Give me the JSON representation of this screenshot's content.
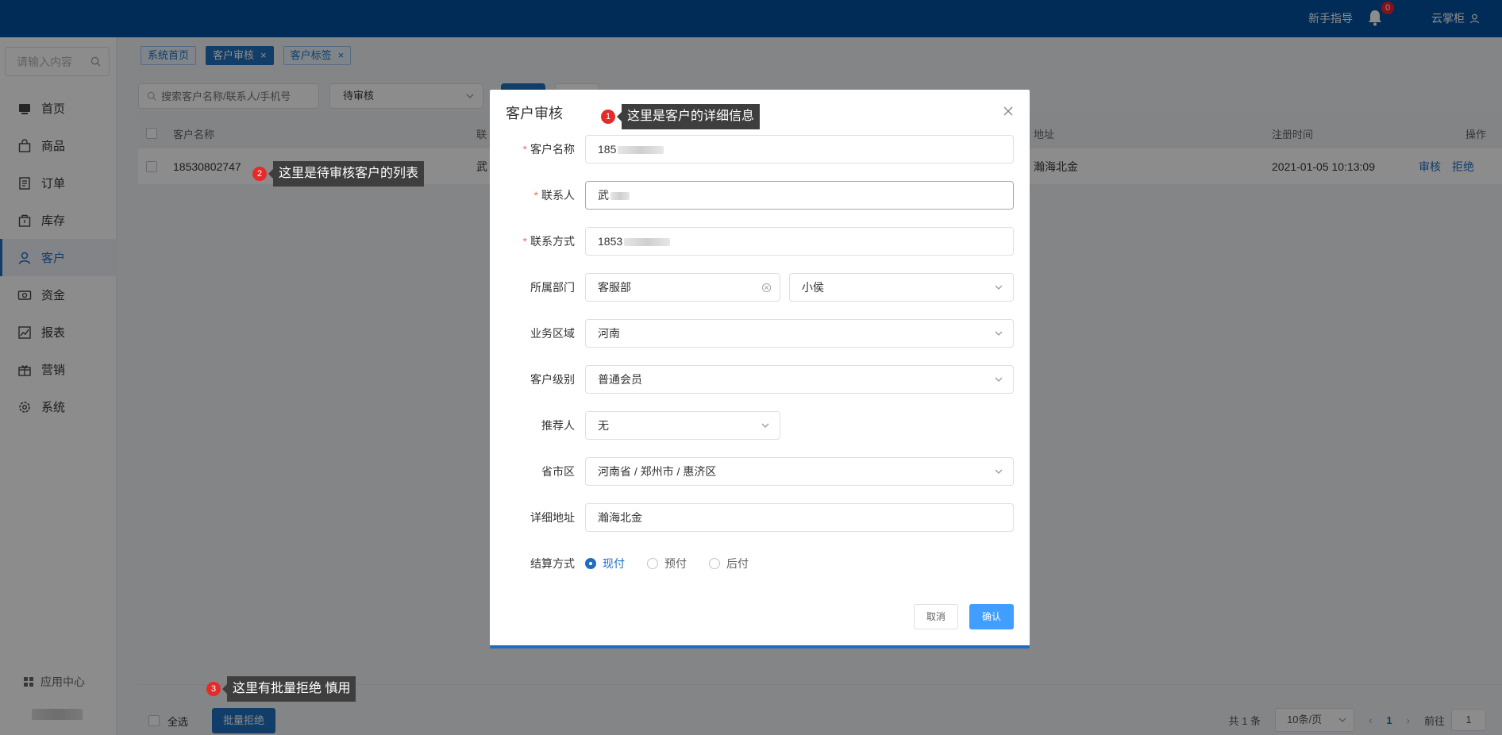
{
  "topbar": {
    "guide": "新手指导",
    "notif_count": "0",
    "user": "云掌柜"
  },
  "sidebar": {
    "search_placeholder": "请输入内容",
    "items": [
      {
        "label": "首页",
        "icon": "home-icon"
      },
      {
        "label": "商品",
        "icon": "bag-icon"
      },
      {
        "label": "订单",
        "icon": "order-icon"
      },
      {
        "label": "库存",
        "icon": "inventory-icon"
      },
      {
        "label": "客户",
        "icon": "user-icon",
        "active": true
      },
      {
        "label": "资金",
        "icon": "money-icon"
      },
      {
        "label": "报表",
        "icon": "chart-icon"
      },
      {
        "label": "营销",
        "icon": "gift-icon"
      },
      {
        "label": "系统",
        "icon": "gear-icon"
      }
    ],
    "app_center": "应用中心"
  },
  "tabs": [
    {
      "label": "系统首页"
    },
    {
      "label": "客户审核",
      "active": true
    },
    {
      "label": "客户标签"
    }
  ],
  "filter": {
    "search_placeholder": "搜索客户名称/联系人/手机号",
    "status": "待审核"
  },
  "table": {
    "headers": {
      "name": "客户名称",
      "contact": "联",
      "address": "地址",
      "reg_time": "注册时间",
      "ops": "操作"
    },
    "rows": [
      {
        "name": "18530802747",
        "contact": "武",
        "address": "瀚海北金",
        "reg_time": "2021-01-05 10:13:09",
        "op_review": "审核",
        "op_reject": "拒绝"
      }
    ]
  },
  "footer": {
    "select_all": "全选",
    "batch_reject": "批量拒绝"
  },
  "pager": {
    "total": "共 1 条",
    "page_size": "10条/页",
    "current": "1",
    "goto_label": "前往",
    "goto_value": "1"
  },
  "callouts": [
    {
      "num": "1",
      "text": "这里是客户的详细信息"
    },
    {
      "num": "2",
      "text": "这里是待审核客户的列表"
    },
    {
      "num": "3",
      "text": "这里有批量拒绝   慎用"
    }
  ],
  "dialog": {
    "title": "客户审核",
    "fields": {
      "name": {
        "label": "客户名称",
        "value": "185"
      },
      "contact": {
        "label": "联系人",
        "value": "武"
      },
      "phone": {
        "label": "联系方式",
        "value": "1853"
      },
      "dept": {
        "label": "所属部门",
        "value": "客服部",
        "staff": "小侯"
      },
      "region": {
        "label": "业务区域",
        "value": "河南"
      },
      "level": {
        "label": "客户级别",
        "value": "普通会员"
      },
      "referrer": {
        "label": "推荐人",
        "value": "无"
      },
      "province": {
        "label": "省市区",
        "value": "河南省 / 郑州市 / 惠济区"
      },
      "address": {
        "label": "详细地址",
        "value": "瀚海北金"
      },
      "settle": {
        "label": "结算方式",
        "options": [
          "现付",
          "预付",
          "后付"
        ],
        "selected": "现付"
      }
    },
    "cancel": "取消",
    "confirm": "确认"
  },
  "colors": {
    "topbar": "#00509e",
    "primary": "#1f6fbf",
    "confirm": "#409eff",
    "badge": "#e52a2a"
  }
}
